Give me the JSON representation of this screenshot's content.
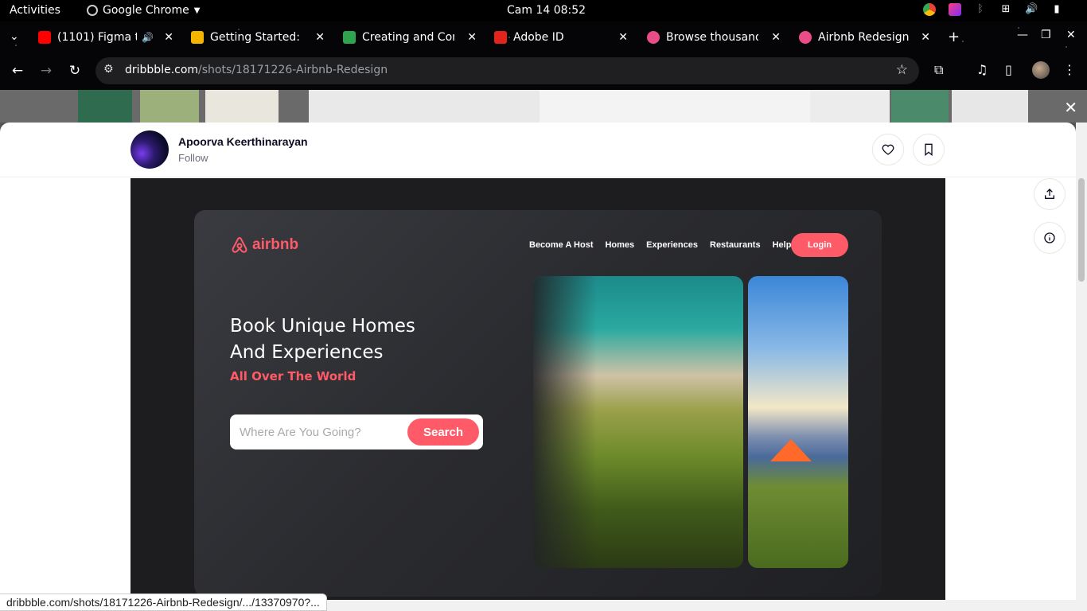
{
  "system": {
    "activities": "Activities",
    "app_name": "Google Chrome",
    "clock": "Cam 14  08:52"
  },
  "tabs": [
    {
      "title": "(1101) Figma t",
      "fav_color": "#ff0000"
    },
    {
      "title": "Getting Started: I",
      "fav_color": "#f4b400"
    },
    {
      "title": "Creating and Con",
      "fav_color": "#2da44e"
    },
    {
      "title": "Adobe ID",
      "fav_color": "#e1251b"
    },
    {
      "title": "Browse thousand",
      "fav_color": "#ea4c89"
    },
    {
      "title": "Airbnb Redesign",
      "fav_color": "#ea4c89"
    }
  ],
  "address": {
    "domain": "dribbble.com",
    "path": "/shots/18171226-Airbnb-Redesign"
  },
  "shot": {
    "author": "Apoorva Keerthinarayan",
    "follow": "Follow"
  },
  "design": {
    "logo": "airbnb",
    "nav": [
      "Become A Host",
      "Homes",
      "Experiences",
      "Restaurants",
      "Help"
    ],
    "login": "Login",
    "headline_1": "Book Unique Homes",
    "headline_2": "And Experiences",
    "subheadline": "All Over The World",
    "search_placeholder": "Where Are You Going?",
    "search_button": "Search",
    "accent_color": "#ff5a68"
  },
  "status_url": "dribbble.com/shots/18171226-Airbnb-Redesign/.../13370970?..."
}
